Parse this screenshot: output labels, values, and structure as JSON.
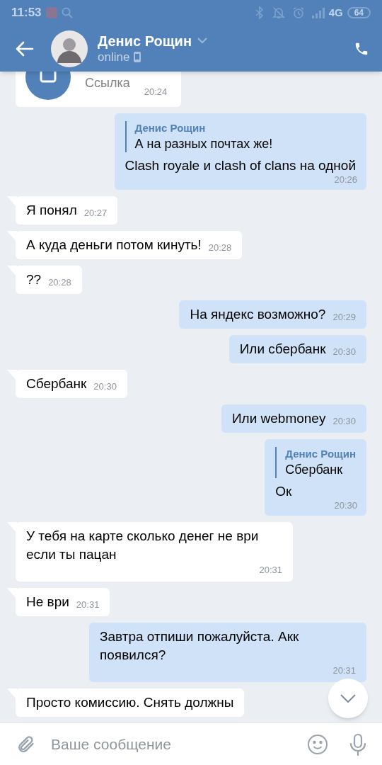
{
  "status_bar": {
    "time": "11:53",
    "network": "4G",
    "battery": "64"
  },
  "header": {
    "name": "Денис Рощин",
    "status": "online"
  },
  "link_message": {
    "label": "Ссылка",
    "time": "20:24"
  },
  "messages": [
    {
      "kind": "out",
      "quote": {
        "author": "Денис Рощин",
        "text": "А на разных почтах же!"
      },
      "text": "Clash royale и clash of clans на одной",
      "time": "20:26"
    },
    {
      "kind": "in",
      "text": "Я понял",
      "time": "20:27"
    },
    {
      "kind": "in",
      "text": "А куда деньги потом кинуть!",
      "time": "20:28"
    },
    {
      "kind": "in",
      "text": "??",
      "time": "20:28"
    },
    {
      "kind": "out",
      "text": "На яндекс возможно?",
      "time": "20:29"
    },
    {
      "kind": "out",
      "text": "Или сбербанк",
      "time": "20:30"
    },
    {
      "kind": "in",
      "text": "Сбербанк",
      "time": "20:30"
    },
    {
      "kind": "out",
      "text": "Или webmoney",
      "time": "20:30"
    },
    {
      "kind": "out",
      "quote": {
        "author": "Денис Рощин",
        "text": "Сбербанк"
      },
      "text": "Ок",
      "time": "20:30"
    },
    {
      "kind": "in",
      "text": "У тебя на карте сколько денег не ври если ты пацан",
      "time": "20:31"
    },
    {
      "kind": "in",
      "text": "Не ври",
      "time": "20:31"
    },
    {
      "kind": "out",
      "text": "Завтра отпиши пожалуйста. Акк появился?",
      "time": "20:31"
    },
    {
      "kind": "in",
      "text": "Просто комиссию. Снять должны"
    }
  ],
  "composer": {
    "placeholder": "Ваше сообщение"
  }
}
